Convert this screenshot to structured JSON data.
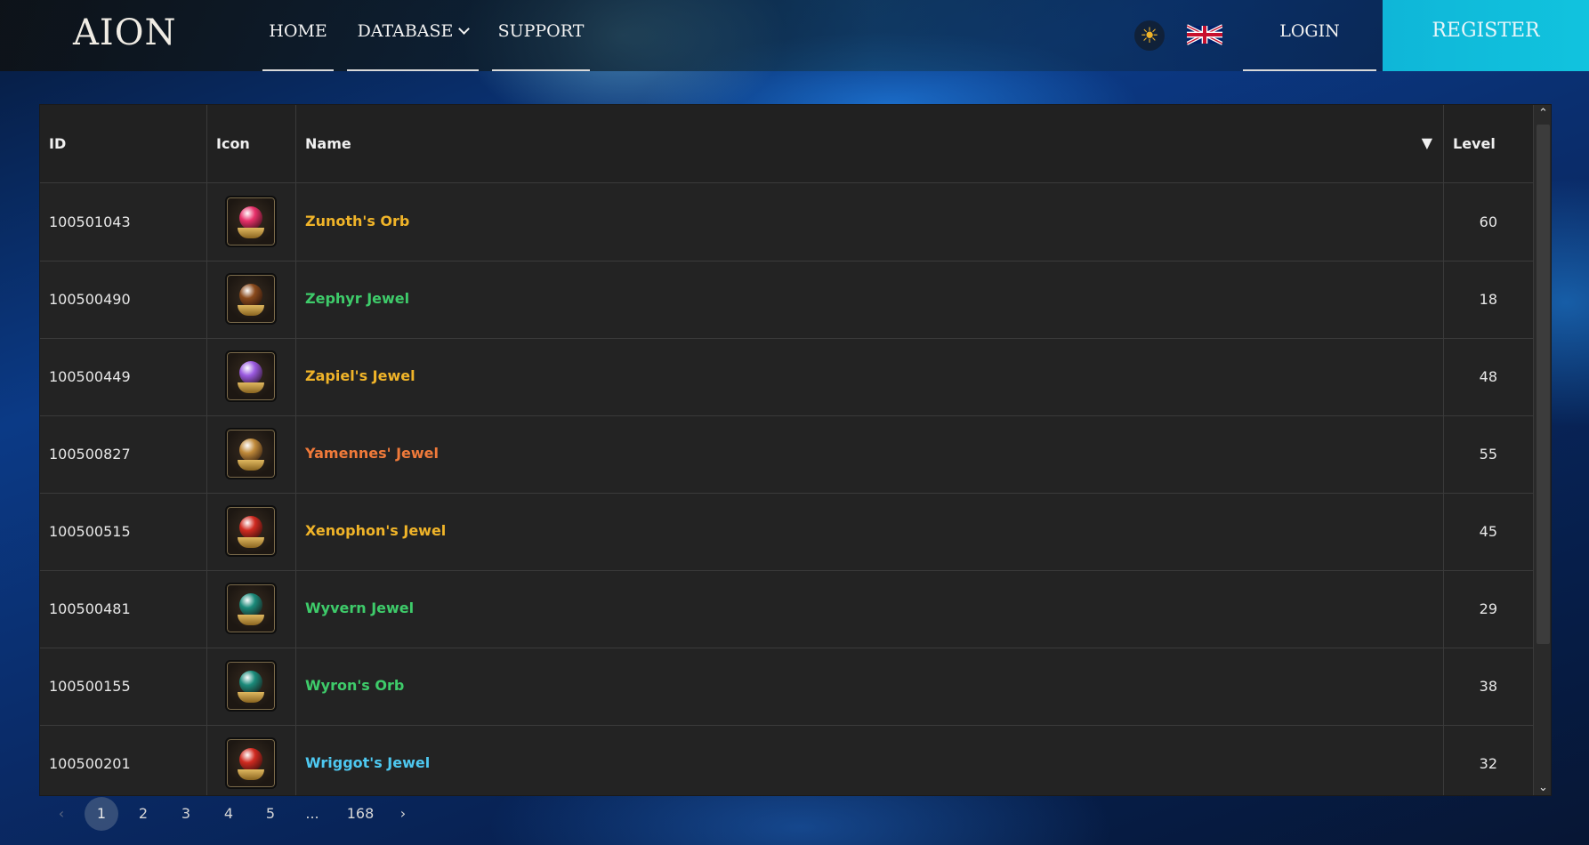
{
  "header": {
    "logo": "AION",
    "nav": {
      "home": "HOME",
      "database": "DATABASE",
      "support": "SUPPORT"
    },
    "theme_icon": "sun-icon",
    "language_flag": "uk-flag-icon",
    "login": "LOGIN",
    "register": "REGISTER"
  },
  "table": {
    "columns": {
      "id": "ID",
      "icon": "Icon",
      "name": "Name",
      "level": "Level"
    },
    "sort_indicator": "▼",
    "rows": [
      {
        "id": "100501043",
        "name": "Zunoth's Orb",
        "level": "60",
        "color": "#f0b429",
        "gem": "#e8306a"
      },
      {
        "id": "100500490",
        "name": "Zephyr Jewel",
        "level": "18",
        "color": "#3ecb6a",
        "gem": "#8a4a1c"
      },
      {
        "id": "100500449",
        "name": "Zapiel's Jewel",
        "level": "48",
        "color": "#f0b429",
        "gem": "#9a5ae0"
      },
      {
        "id": "100500827",
        "name": "Yamennes' Jewel",
        "level": "55",
        "color": "#f07a3a",
        "gem": "#c08a3a"
      },
      {
        "id": "100500515",
        "name": "Xenophon's Jewel",
        "level": "45",
        "color": "#f0b429",
        "gem": "#d02a20"
      },
      {
        "id": "100500481",
        "name": "Wyvern Jewel",
        "level": "29",
        "color": "#3ecb6a",
        "gem": "#1a8a7a"
      },
      {
        "id": "100500155",
        "name": "Wyron's Orb",
        "level": "38",
        "color": "#3ecb6a",
        "gem": "#1a8a7a"
      },
      {
        "id": "100500201",
        "name": "Wriggot's Jewel",
        "level": "32",
        "color": "#4ec8f0",
        "gem": "#d02a20"
      }
    ]
  },
  "pagination": {
    "prev": "‹",
    "pages": [
      "1",
      "2",
      "3",
      "4",
      "5"
    ],
    "ellipsis": "...",
    "last": "168",
    "next": "›",
    "current": "1"
  }
}
